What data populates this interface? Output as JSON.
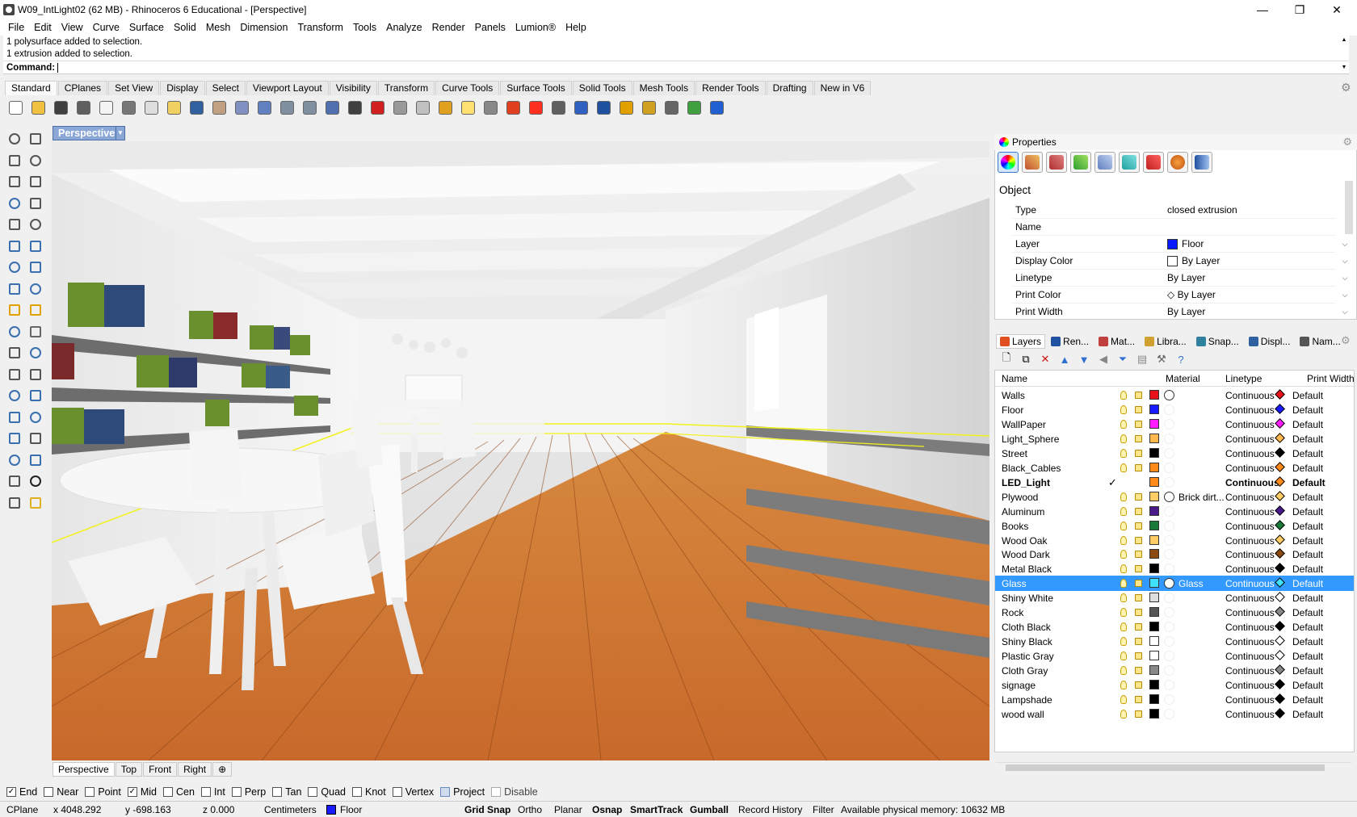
{
  "window": {
    "title": "W09_IntLight02 (62 MB) - Rhinoceros 6 Educational - [Perspective]",
    "controls": {
      "minimize": "—",
      "maximize": "❐",
      "close": "✕"
    }
  },
  "menu": [
    "File",
    "Edit",
    "View",
    "Curve",
    "Surface",
    "Solid",
    "Mesh",
    "Dimension",
    "Transform",
    "Tools",
    "Analyze",
    "Render",
    "Panels",
    "Lumion®",
    "Help"
  ],
  "command": {
    "history": [
      "1 polysurface added to selection.",
      "1 extrusion added to selection."
    ],
    "prompt": "Command:"
  },
  "toolbar_tabs": [
    "Standard",
    "CPlanes",
    "Set View",
    "Display",
    "Select",
    "Viewport Layout",
    "Visibility",
    "Transform",
    "Curve Tools",
    "Surface Tools",
    "Solid Tools",
    "Mesh Tools",
    "Render Tools",
    "Drafting",
    "New in V6"
  ],
  "toolbar_icons": [
    "new-file",
    "open-file",
    "save",
    "print",
    "import",
    "cut",
    "copy",
    "paste",
    "undo",
    "pan",
    "move-view",
    "zoom",
    "zoom-window",
    "zoom-extents",
    "rotate-view",
    "four-viewports",
    "car",
    "properties",
    "cplane",
    "snap",
    "light",
    "lock",
    "layer",
    "color-wheel",
    "shade",
    "render",
    "render-preview",
    "filter",
    "gear",
    "grid",
    "globe",
    "help"
  ],
  "viewport": {
    "name": "Perspective",
    "tabs": [
      "Perspective",
      "Top",
      "Front",
      "Right",
      "⊕"
    ]
  },
  "properties": {
    "title": "Properties",
    "section": "Object",
    "rows": [
      {
        "label": "Type",
        "value": "closed extrusion"
      },
      {
        "label": "Name",
        "value": ""
      },
      {
        "label": "Layer",
        "value": "Floor",
        "swatch": "#0a1aff"
      },
      {
        "label": "Display Color",
        "value": "By Layer",
        "swatch": "#ffffff"
      },
      {
        "label": "Linetype",
        "value": "By Layer"
      },
      {
        "label": "Print Color",
        "value": "◇ By Layer"
      },
      {
        "label": "Print Width",
        "value": "By Layer"
      }
    ]
  },
  "panel_tabs": [
    "Layers",
    "Ren...",
    "Mat...",
    "Libra...",
    "Snap...",
    "Displ...",
    "Nam..."
  ],
  "layers": {
    "columns": {
      "name": "Name",
      "material": "Material",
      "linetype": "Linetype",
      "print_width": "Print Width"
    },
    "rows": [
      {
        "name": "Walls",
        "color": "#e8121a",
        "material": "",
        "mat_circle": true,
        "linetype": "Continuous",
        "pw": "Default",
        "pc": "#e8121a"
      },
      {
        "name": "Floor",
        "color": "#1a1aff",
        "material": "",
        "linetype": "Continuous",
        "pw": "Default",
        "pc": "#1a1aff"
      },
      {
        "name": "WallPaper",
        "color": "#ff1aff",
        "material": "",
        "linetype": "Continuous",
        "pw": "Default",
        "pc": "#ff1aff"
      },
      {
        "name": "Light_Sphere",
        "color": "#ffb84d",
        "material": "",
        "linetype": "Continuous",
        "pw": "Default",
        "pc": "#ffb84d"
      },
      {
        "name": "Street",
        "color": "#000000",
        "material": "",
        "linetype": "Continuous",
        "pw": "Default",
        "pc": "#000000"
      },
      {
        "name": "Black_Cables",
        "color": "#ff8a1a",
        "material": "",
        "linetype": "Continuous",
        "pw": "Default",
        "pc": "#ff8a1a"
      },
      {
        "name": "LED_Light",
        "color": "#ff8a1a",
        "material": "",
        "current": true,
        "linetype": "Continuous",
        "pw": "Default",
        "pc": "#ff8a1a"
      },
      {
        "name": "Plywood",
        "color": "#ffcc66",
        "material": "Brick dirt...",
        "mat_circle": true,
        "linetype": "Continuous",
        "pw": "Default",
        "pc": "#ffcc66"
      },
      {
        "name": "Aluminum",
        "color": "#4b1a8a",
        "material": "",
        "linetype": "Continuous",
        "pw": "Default",
        "pc": "#4b1a8a"
      },
      {
        "name": "Books",
        "color": "#1a7a3a",
        "material": "",
        "linetype": "Continuous",
        "pw": "Default",
        "pc": "#1a7a3a"
      },
      {
        "name": "Wood Oak",
        "color": "#ffcc66",
        "material": "",
        "linetype": "Continuous",
        "pw": "Default",
        "pc": "#ffcc66"
      },
      {
        "name": "Wood Dark",
        "color": "#8a4a10",
        "material": "",
        "linetype": "Continuous",
        "pw": "Default",
        "pc": "#8a4a10"
      },
      {
        "name": "Metal Black",
        "color": "#000000",
        "material": "",
        "linetype": "Continuous",
        "pw": "Default",
        "pc": "#000000"
      },
      {
        "name": "Glass",
        "color": "#40e0ff",
        "material": "Glass",
        "mat_circle": true,
        "selected": true,
        "linetype": "Continuous",
        "pw": "Default",
        "pc": "#40e0ff"
      },
      {
        "name": "Shiny White",
        "color": "#dddddd",
        "material": "",
        "linetype": "Continuous",
        "pw": "Default",
        "pc": "#ffffff"
      },
      {
        "name": "Rock",
        "color": "#555555",
        "material": "",
        "linetype": "Continuous",
        "pw": "Default",
        "pc": "#888888"
      },
      {
        "name": "Cloth Black",
        "color": "#000000",
        "material": "",
        "linetype": "Continuous",
        "pw": "Default",
        "pc": "#000000"
      },
      {
        "name": "Shiny Black",
        "color": "#ffffff",
        "material": "",
        "linetype": "Continuous",
        "pw": "Default",
        "pc": "#ffffff"
      },
      {
        "name": "Plastic Gray",
        "color": "#ffffff",
        "material": "",
        "linetype": "Continuous",
        "pw": "Default",
        "pc": "#ffffff"
      },
      {
        "name": "Cloth Gray",
        "color": "#888888",
        "material": "",
        "linetype": "Continuous",
        "pw": "Default",
        "pc": "#888888"
      },
      {
        "name": "signage",
        "color": "#000000",
        "material": "",
        "linetype": "Continuous",
        "pw": "Default",
        "pc": "#000000"
      },
      {
        "name": "Lampshade",
        "color": "#000000",
        "material": "",
        "linetype": "Continuous",
        "pw": "Default",
        "pc": "#000000"
      },
      {
        "name": "wood wall",
        "color": "#000000",
        "material": "",
        "linetype": "Continuous",
        "pw": "Default",
        "pc": "#000000"
      }
    ]
  },
  "osnaps": [
    {
      "label": "End",
      "checked": true
    },
    {
      "label": "Near",
      "checked": false
    },
    {
      "label": "Point",
      "checked": false
    },
    {
      "label": "Mid",
      "checked": true
    },
    {
      "label": "Cen",
      "checked": false
    },
    {
      "label": "Int",
      "checked": false
    },
    {
      "label": "Perp",
      "checked": false
    },
    {
      "label": "Tan",
      "checked": false
    },
    {
      "label": "Quad",
      "checked": false
    },
    {
      "label": "Knot",
      "checked": false
    },
    {
      "label": "Vertex",
      "checked": false
    },
    {
      "label": "Project",
      "checked": false,
      "shaded": true
    },
    {
      "label": "Disable",
      "checked": false,
      "disabled": true
    }
  ],
  "status": {
    "cplane": "CPlane",
    "x": "x 4048.292",
    "y": "y -698.163",
    "z": "z 0.000",
    "units": "Centimeters",
    "layer": "Floor",
    "layer_color": "#1a1aff",
    "grid_snap": "Grid Snap",
    "ortho": "Ortho",
    "planar": "Planar",
    "osnap": "Osnap",
    "smarttrack": "SmartTrack",
    "gumball": "Gumball",
    "record_history": "Record History",
    "filter": "Filter",
    "memory": "Available physical memory: 10632 MB"
  }
}
